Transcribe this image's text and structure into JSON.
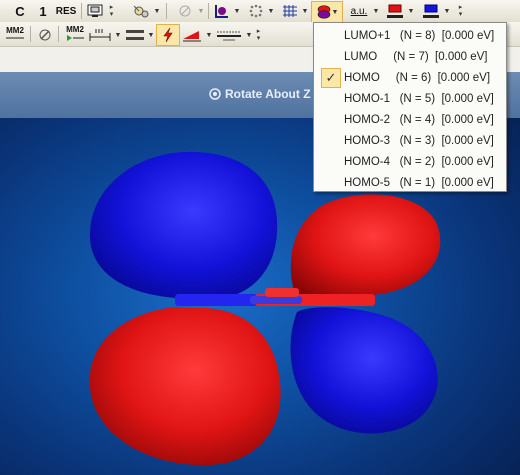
{
  "toolbar1": {
    "btn_c": "C",
    "btn_1": "1",
    "btn_res": "RES",
    "btn_au": "a.u."
  },
  "toolbar2": {
    "btn_mm2": "MM2",
    "btn_mm2b": "MM2"
  },
  "viewport": {
    "rotate_label": "Rotate About Z"
  },
  "colors": {
    "positive_lobe": "#e01414",
    "negative_lobe": "#1414e0",
    "background": "#0e4fa0",
    "menu_check_bg": "#fbe7a7"
  },
  "orbital_menu": {
    "items": [
      {
        "label": "LUMO+1   (N = 8)  [0.000 eV]",
        "checked": false
      },
      {
        "label": "LUMO     (N = 7)  [0.000 eV]",
        "checked": false
      },
      {
        "label": "HOMO     (N = 6)  [0.000 eV]",
        "checked": true
      },
      {
        "label": "HOMO-1   (N = 5)  [0.000 eV]",
        "checked": false
      },
      {
        "label": "HOMO-2   (N = 4)  [0.000 eV]",
        "checked": false
      },
      {
        "label": "HOMO-3   (N = 3)  [0.000 eV]",
        "checked": false
      },
      {
        "label": "HOMO-4   (N = 2)  [0.000 eV]",
        "checked": false
      },
      {
        "label": "HOMO-5   (N = 1)  [0.000 eV]",
        "checked": false
      }
    ]
  }
}
